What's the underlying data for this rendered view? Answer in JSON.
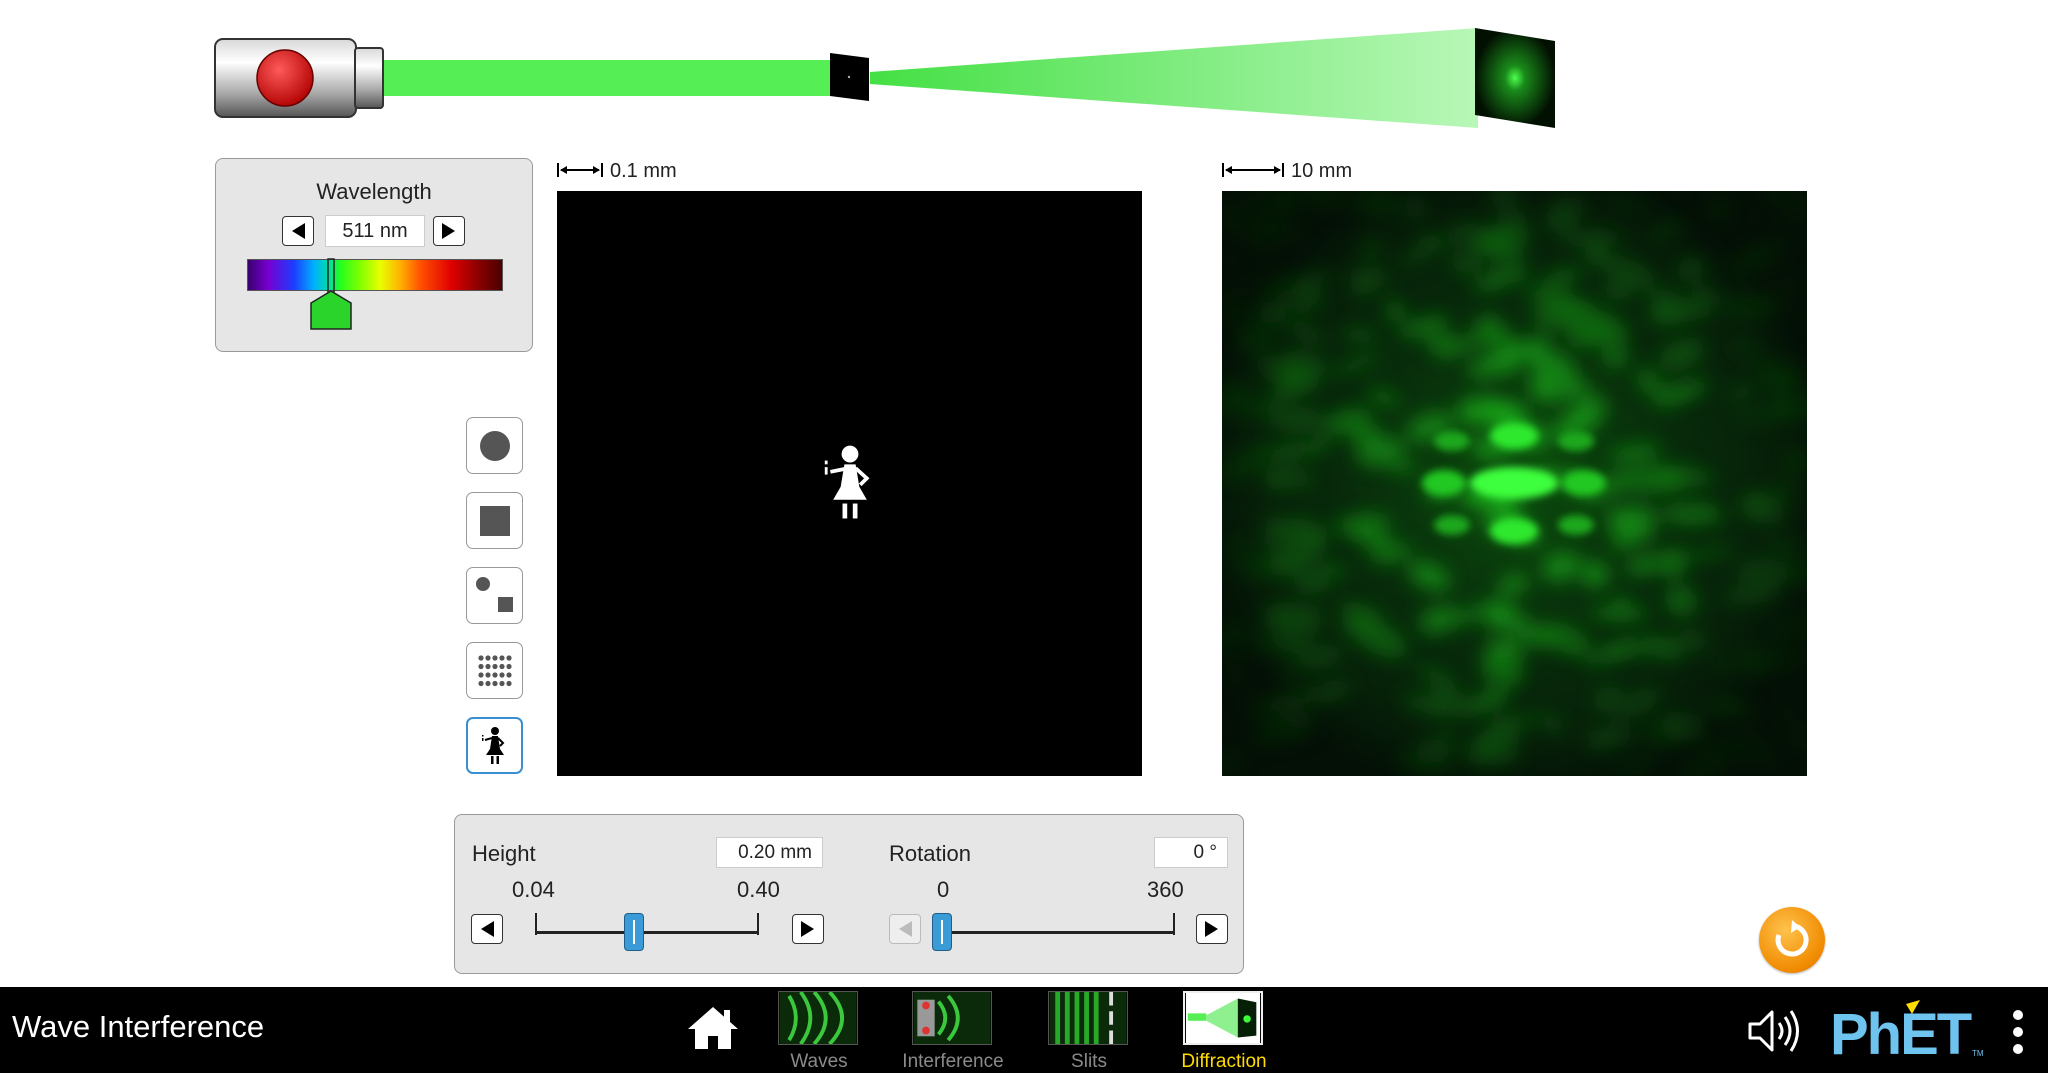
{
  "app": {
    "title": "Wave Interference"
  },
  "wavelength_panel": {
    "title": "Wavelength",
    "value": "511 nm",
    "level_fraction": 0.33,
    "color": "#2bd42b"
  },
  "scales": {
    "aperture": "0.1 mm",
    "pattern": "10 mm"
  },
  "controls": {
    "height": {
      "label": "Height",
      "value": "0.20 mm",
      "min_label": "0.04",
      "max_label": "0.40",
      "level_fraction": 0.444
    },
    "rotation": {
      "label": "Rotation",
      "value": "0 °",
      "min_label": "0",
      "max_label": "360",
      "level_fraction": 0.0
    }
  },
  "aperture_buttons": [
    "circle-aperture",
    "square-aperture",
    "gaussian-aperture",
    "lattice-aperture",
    "wave-ingenue-aperture"
  ],
  "tabs": [
    {
      "label": "Waves",
      "active": false
    },
    {
      "label": "Interference",
      "active": false
    },
    {
      "label": "Slits",
      "active": false
    },
    {
      "label": "Diffraction",
      "active": true
    }
  ],
  "colors": {
    "beam": "#55ee55",
    "accent": "#3a8fd0",
    "active_tab": "#ffdd00",
    "reset": "#f08a00"
  }
}
